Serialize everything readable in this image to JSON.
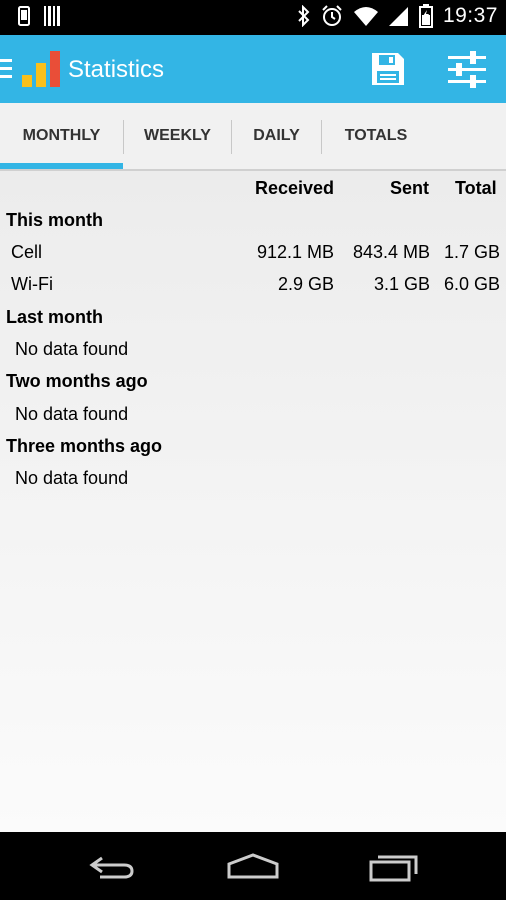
{
  "status_bar": {
    "time": "19:37"
  },
  "app_bar": {
    "title": "Statistics"
  },
  "tabs": [
    "MONTHLY",
    "WEEKLY",
    "DAILY",
    "TOTALS"
  ],
  "columns": {
    "received": "Received",
    "sent": "Sent",
    "total": "Total"
  },
  "sections": [
    {
      "title": "This month",
      "rows": [
        {
          "label": "Cell",
          "received": "912.1 MB",
          "sent": "843.4 MB",
          "total": "1.7 GB"
        },
        {
          "label": "Wi-Fi",
          "received": "2.9 GB",
          "sent": "3.1 GB",
          "total": "6.0 GB"
        }
      ]
    },
    {
      "title": "Last month",
      "empty_text": "No data found"
    },
    {
      "title": "Two months ago",
      "empty_text": "No data found"
    },
    {
      "title": "Three months ago",
      "empty_text": "No data found"
    }
  ],
  "colors": {
    "accent": "#33b5e5",
    "logo_yellow": "#f9c01c",
    "logo_red": "#e94e38"
  }
}
